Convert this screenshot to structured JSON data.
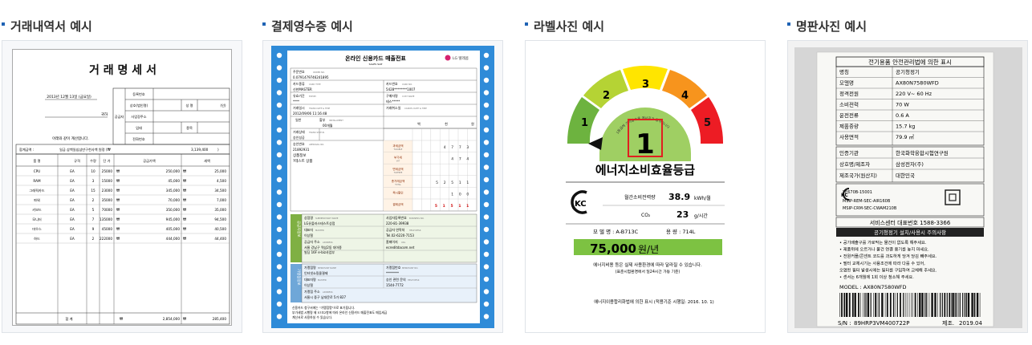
{
  "panels": [
    {
      "title": "거래내역서 예시"
    },
    {
      "title": "결제영수증 예시"
    },
    {
      "title": "라벨사진 예시"
    },
    {
      "title": "명판사진 예시"
    }
  ],
  "invoice": {
    "title": "거 래 명 세 서",
    "date": "2013년 12월 13일 (금요일)",
    "recipient": "귀하",
    "request": "아래와 같이 계산합니다.",
    "supplier_labels": [
      "등록번호",
      "상호(법인명)",
      "성 명",
      "(인)",
      "사업장주소",
      "업태",
      "종목",
      "전화번호"
    ],
    "supplier_vertical": "공급자",
    "total_label": "합계금액 :",
    "total_text": "일금 삼백일십삼만구천사백 원정 (₩",
    "total_value": "3,139,400",
    "headers": [
      "품 명",
      "규격",
      "수량",
      "단 가",
      "공급가액",
      "세액"
    ],
    "rows": [
      [
        "CPU",
        "EA",
        "10",
        "25000",
        "250,000",
        "25,000"
      ],
      [
        "RAM",
        "EA",
        "3",
        "15000",
        "45,000",
        "4,500"
      ],
      [
        "그래픽카드",
        "EA",
        "15",
        "23000",
        "345,000",
        "34,500"
      ],
      [
        "파워",
        "EA",
        "2",
        "35000",
        "70,000",
        "7,000"
      ],
      [
        "키보드",
        "EA",
        "5",
        "70000",
        "350,000",
        "35,000"
      ],
      [
        "모니터",
        "EA",
        "7",
        "135000",
        "945,000",
        "94,500"
      ],
      [
        "마우스",
        "EA",
        "9",
        "45000",
        "405,000",
        "40,500"
      ],
      [
        "하드",
        "EA",
        "2",
        "222000",
        "444,000",
        "44,400"
      ]
    ],
    "won_sign": "₩",
    "sum_label": "합 계",
    "sum_supply": "2,854,000",
    "sum_tax": "285,400"
  },
  "receipt": {
    "title": "온라인 신용카드 매출전표",
    "subtitle": "SALES SLIP",
    "logo": "LG 텔레콤",
    "order_label": "주문번호",
    "order_label_en": "ORDER NO.",
    "order_no": "0.0791479746241895",
    "card_type_label": "카드종류",
    "card_type_en": "CARD TYPE",
    "card_no_label": "카드번호",
    "card_no_en": "CARD NO.",
    "card_type": "신한MASTER",
    "card_no": "5428********1007",
    "expiry_label": "유효기간",
    "expiry_en": "EXPIRY",
    "buyer_label": "구매자명",
    "buyer_en": "CUST NAME",
    "expiry": "****",
    "buyer": "테스*****",
    "trans_date_label": "거래일시",
    "trans_date_en": "TRANS DATE & TIME",
    "cancel_label": "거래취소일",
    "cancel_en": "CANCEL DATE & TIME",
    "trans_date": "2012/09/06 11:16:48",
    "pay_label": "일반",
    "installment_label": "할부",
    "installment_en": "INSTALLMENT",
    "installment": "00개월",
    "status_label": "거래상태",
    "status_en": "TRANS STATUS",
    "status": "승인성공",
    "approval_label": "승인번호",
    "approval_en": "APPROVAL NO.",
    "approval": "21892931",
    "product_label": "상품정보",
    "product": "?테스트 상품",
    "amount_units": [
      "백",
      "천",
      "원"
    ],
    "amount_rows": [
      {
        "label": "과세금액",
        "en": "TAXABLE",
        "digits": "4773"
      },
      {
        "label": "부가세",
        "en": "VAT",
        "digits": "474"
      },
      {
        "label": "면세금액",
        "en": "TAXFREE",
        "digits": ""
      },
      {
        "label": "총거래금액",
        "en": "TOTAL",
        "digits": "52511"
      },
      {
        "label": "즉시할인",
        "en": "",
        "digits": "100"
      },
      {
        "label": "결제금액",
        "en": "",
        "digits": "51511"
      }
    ],
    "merchant_side": "공급자정보",
    "merchant_label": "상점명",
    "merchant_en": "SUBMERCHANT NAME",
    "biz_label": "사업자등록번호",
    "biz_en": "BUSINESS NO.",
    "merchant": "LG유플러스테스트상점",
    "biz_no": "220-81-39938",
    "rep_label": "대표자",
    "rep_en": "MASTER",
    "phone_label": "공급자 연락처",
    "phone_en": "HELP DESK",
    "rep": "이상철",
    "phone": "Tel.02-6220-7153",
    "addr_label": "공급자 주소",
    "addr_en": "ADDRESS",
    "home_label": "홈페이지",
    "home_en": "URL",
    "addr": "서울 강남구 역삼2동 대아종",
    "addr2": "빌딩 16F e-biz사업부",
    "home": "ecreditdacom.net",
    "pg_side": "가맹점정보",
    "pg_label": "가맹점명",
    "pg_en": "MERCHANT NAME",
    "pg_no_label": "가맹점번호",
    "pg_no_en": "MERCHANT NO.",
    "pg_name": "인터넷쇼핑몰결제",
    "pg_no": "********",
    "pg_rep_label": "대표자명",
    "pg_rep_en": "MASTER",
    "help_label": "승인 관련 문의",
    "help_en": "HELP DESK",
    "pg_rep": "이상철",
    "help": "1544-7772",
    "pg_addr_label": "가맹점 주소",
    "pg_addr_en": "ADDRESS",
    "pg_addr": "서울시 중구 남대문로 5가 827",
    "note1": "신용카드 청구서에는 \"가맹점명\"으로 표기됩니다.",
    "note2": "부가세법 시행령 제 57조2항에 따라 온라인 신용카드 매출전표도 매입세금",
    "note3": "계산서로 사용하실 수 있습니다."
  },
  "label": {
    "grades": [
      "1",
      "2",
      "3",
      "4",
      "5"
    ],
    "big_grade": "1",
    "arc_text": "1등급에 가까울수록 에너지가 절약됩니다",
    "title": "에너지소비효율등급",
    "mark": "KC",
    "row1_label": "월간소비전력량",
    "row1_value": "38.9",
    "row1_unit": "kWh/월",
    "row2_label": "CO₂",
    "row2_value": "23",
    "row2_unit": "g/시간",
    "model_text": "모 델 명 : A-B713C",
    "capacity_text": "용 량 : 714L",
    "cost": "75,000",
    "cost_unit": "원/년",
    "note1": "에너지비용 등은 실제 사용환경에 따라 달라질 수 있습니다.",
    "note2": "(표준시험환경에서 일24시간 가동 기준)",
    "footer": "에너지이용합리화법에 의한 표시 (적용기준 시행일: 2016. 10. 1)"
  },
  "nameplate": {
    "header": "전기용품 안전관리법에 의한 표시",
    "rows": [
      [
        "명칭",
        "공기청정기"
      ],
      [
        "모델명",
        "AX80N7580WFD"
      ],
      [
        "정격전원",
        "220 V~ 60 Hz"
      ],
      [
        "소비전력",
        "70 W"
      ],
      [
        "운전전류",
        "0.6 A"
      ],
      [
        "제품중량",
        "15.7 kg"
      ],
      [
        "사용면적",
        "79.9 ㎡"
      ]
    ],
    "rows2": [
      [
        "인증기관",
        "한국화학융합시험연구원"
      ],
      [
        "상호명/제조자",
        "삼성전자(주)"
      ],
      [
        "제조국가(원산지)",
        "대한민국"
      ]
    ],
    "cert_mark": "KC",
    "cert_lines": [
      "YE670B-15001",
      "MSIP-REM-SEC-AIR160B",
      "MSIP-CRM-SEC-CWAM210B"
    ],
    "service": "서비스센터 대표번호 1588-3366",
    "caution_title": "공기청정기 설치/사용시 주의사항",
    "cautions": [
      "• 공기배출구를 가로막는 물건이 없도록 해주세요.",
      "• 제품위에 오르거나 물건 연결 용기를 놓지 마세요.",
      "• 전원커플/콘센트 코드를 과도하게 당겨 당김 빼주세요.",
      "• 필터 교체시기는 사용조건에 따라 다를 수 있어,",
      "  오염된 필터 발생시에는 필터를 구입하여 교체해 주세요.",
      "• 센서는 6개월에 1회 이상 청소해 주세요."
    ],
    "model_line": "MODEL : AX80N7580WFD",
    "serial_label": "S/N : ",
    "serial": "89HRP3VM400722P",
    "date_label": "제조.",
    "date": "2019.04"
  }
}
